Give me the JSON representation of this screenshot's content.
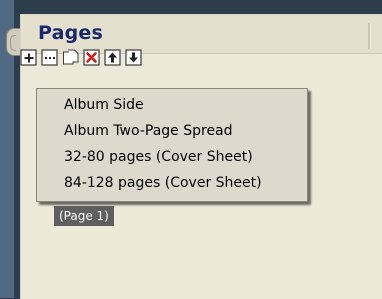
{
  "panel": {
    "title": "Pages"
  },
  "toolbar": {
    "buttons": [
      {
        "icon": "add-page-icon"
      },
      {
        "icon": "page-options-icon"
      },
      {
        "icon": "duplicate-page-icon"
      },
      {
        "icon": "delete-page-icon"
      },
      {
        "icon": "move-up-icon"
      },
      {
        "icon": "move-down-icon"
      }
    ]
  },
  "menu": {
    "items": [
      {
        "label": "Album Side"
      },
      {
        "label": "Album Two-Page Spread"
      },
      {
        "label": "32-80 pages (Cover Sheet)"
      },
      {
        "label": "84-128 pages (Cover Sheet)"
      }
    ]
  },
  "page_list": {
    "selected_label": "(Page 1)"
  },
  "colors": {
    "title": "#17286e",
    "panel_bg": "#ece9d8",
    "delete_icon": "#d21a1a",
    "selection_bg": "#5f5f5f"
  }
}
